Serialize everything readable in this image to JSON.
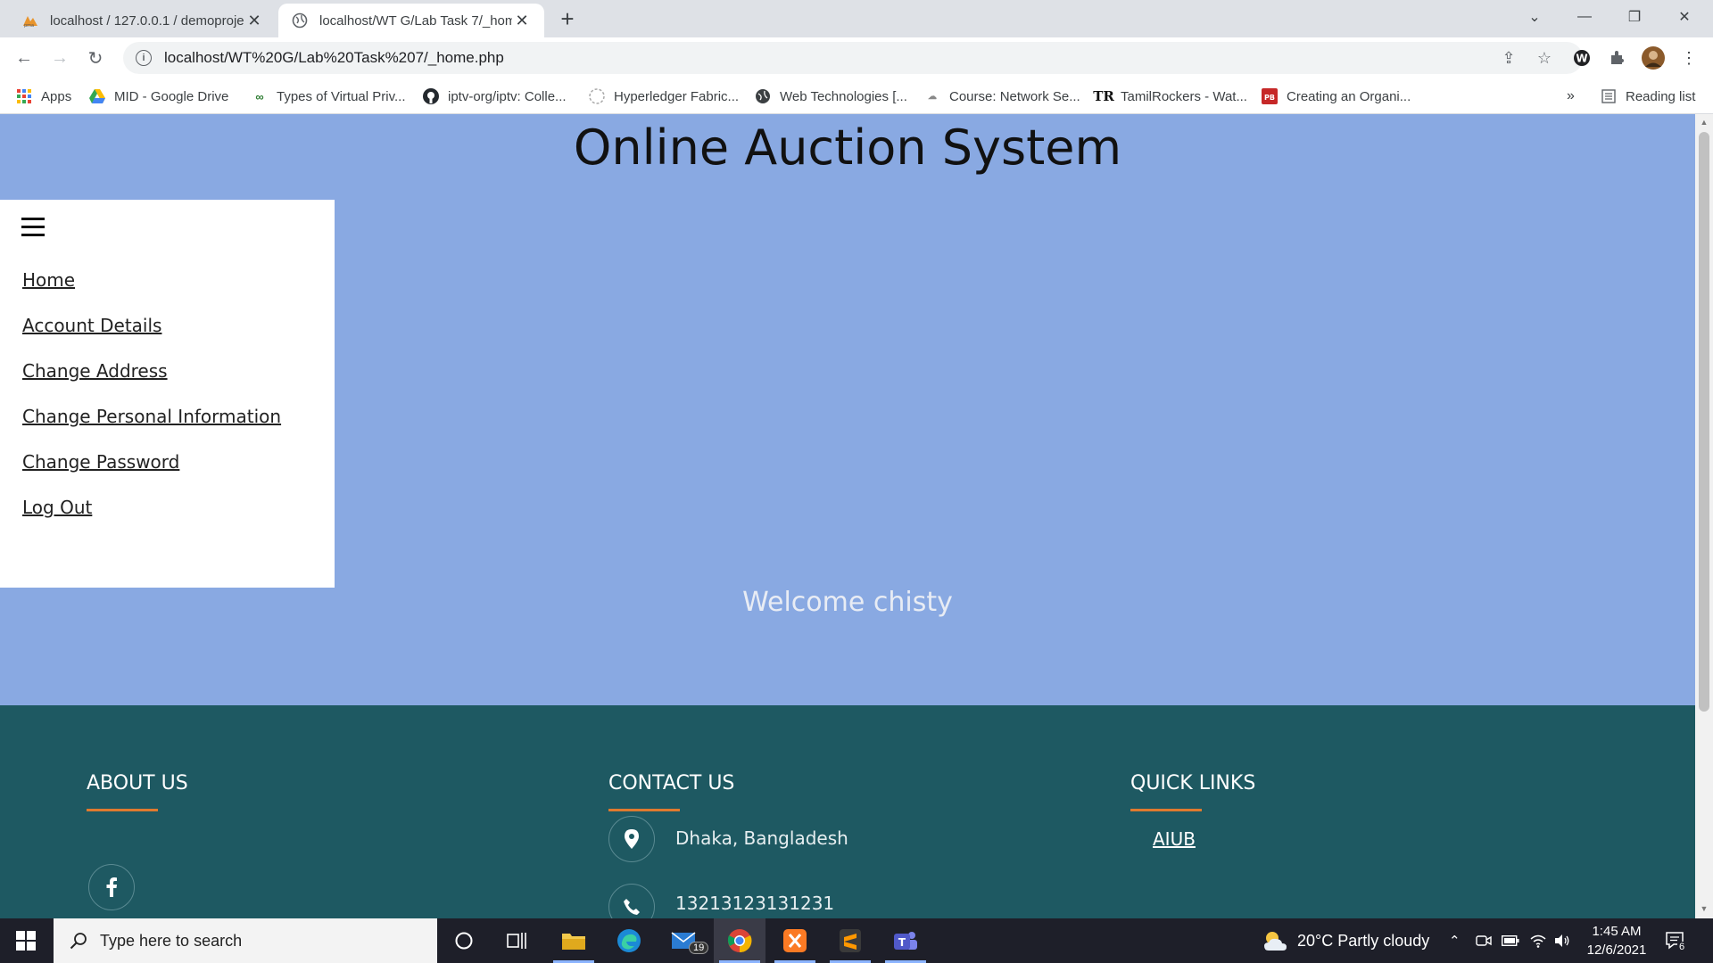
{
  "browser": {
    "tabs": [
      {
        "title": "localhost / 127.0.0.1 / demoproje",
        "active": false
      },
      {
        "title": "localhost/WT G/Lab Task 7/_hom",
        "active": true
      }
    ],
    "url": "localhost/WT%20G/Lab%20Task%207/_home.php",
    "bookmarks": [
      {
        "label": "Apps",
        "icon": "apps-grid-icon"
      },
      {
        "label": "MID - Google Drive",
        "icon": "google-drive-icon"
      },
      {
        "label": "Types of Virtual Priv...",
        "icon": "site-icon"
      },
      {
        "label": "iptv-org/iptv: Colle...",
        "icon": "github-icon"
      },
      {
        "label": "Hyperledger Fabric...",
        "icon": "hyperledger-icon"
      },
      {
        "label": "Web Technologies [...",
        "icon": "globe-icon"
      },
      {
        "label": "Course: Network Se...",
        "icon": "course-icon"
      },
      {
        "label": "TamilRockers - Wat...",
        "icon": "tr-icon"
      },
      {
        "label": "Creating an Organi...",
        "icon": "pb-icon"
      }
    ],
    "reading_list": "Reading list"
  },
  "page": {
    "title": "Online Auction System",
    "nav": [
      "Home",
      "Account Details",
      "Change Address",
      "Change Personal Information",
      "Change Password",
      "Log Out"
    ],
    "welcome": "Welcome chisty",
    "footer": {
      "about_heading": "ABOUT US",
      "contact_heading": "CONTACT US",
      "links_heading": "QUICK LINKS",
      "address": "Dhaka, Bangladesh",
      "phone": "13213123131231",
      "quick_link": "AIUB"
    }
  },
  "taskbar": {
    "search_placeholder": "Type here to search",
    "mail_badge": "19",
    "weather": "20°C  Partly cloudy",
    "time": "1:45 AM",
    "date": "12/6/2021",
    "notification_count": "6"
  },
  "colors": {
    "page_bg": "#89a9e2",
    "footer_bg": "#1e5962",
    "accent": "#e07a2f"
  }
}
